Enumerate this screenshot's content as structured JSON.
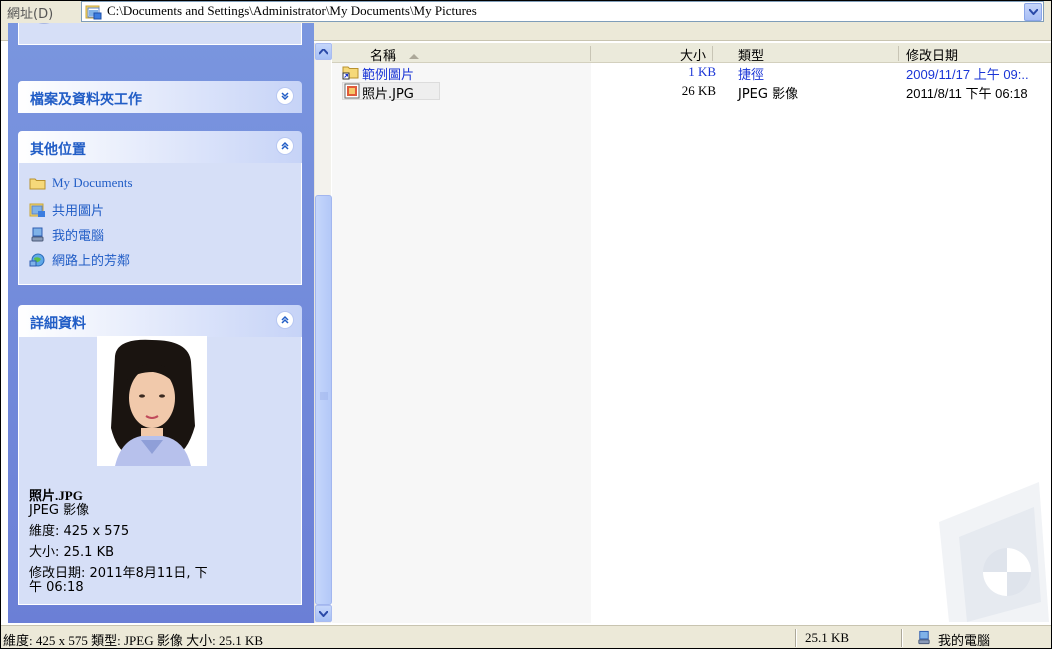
{
  "address": {
    "label": "網址(D)",
    "path": "C:\\Documents and Settings\\Administrator\\My Documents\\My Pictures"
  },
  "tasks": {
    "file_folder_tasks": "檔案及資料夾工作",
    "other_places": {
      "title": "其他位置",
      "items": [
        "My Documents",
        "共用圖片",
        "我的電腦",
        "網路上的芳鄰"
      ]
    },
    "details": {
      "title": "詳細資料",
      "name": "照片.JPG",
      "type": "JPEG 影像",
      "dimensions": "維度: 425 x 575",
      "size": "大小: 25.1 KB",
      "modified_line1": "修改日期: 2011年8月11日, 下",
      "modified_line2": "午 06:18"
    }
  },
  "columns": {
    "name": "名稱",
    "size": "大小",
    "type": "類型",
    "modified": "修改日期"
  },
  "files": [
    {
      "name": "範例圖片",
      "size": "1 KB",
      "type": "捷徑",
      "modified": "2009/11/17 上午 09:..",
      "icon": "shortcut-folder-icon"
    },
    {
      "name": "照片.JPG",
      "size": "26 KB",
      "type": "JPEG 影像",
      "modified": "2011/8/11 下午 06:18",
      "icon": "jpeg-file-icon"
    }
  ],
  "status": {
    "info": "維度: 425 x 575 類型: JPEG 影像 大小: 25.1 KB",
    "size": "25.1 KB",
    "location": "我的電腦"
  },
  "colors": {
    "task_pane": "#6b7fd6",
    "panel_title": "#215dc6",
    "link_blue": "#1a35d6"
  }
}
